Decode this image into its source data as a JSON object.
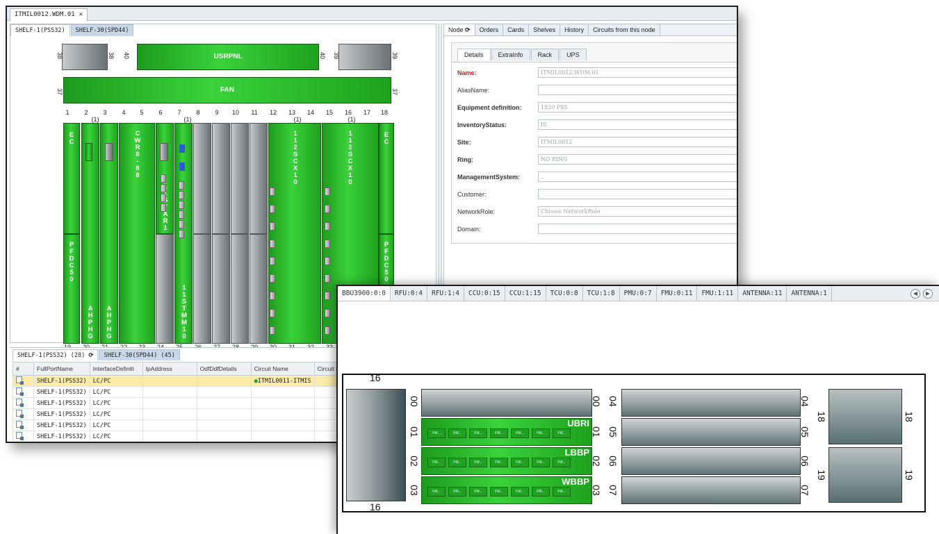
{
  "window_a": {
    "doc_tab": "ITMIL0012.WDM.01",
    "shelf_tabs": [
      "SHELF-1(PSS32)",
      "SHELF-30(SPD44)"
    ],
    "rack": {
      "top_labels": {
        "usrpnl": "USRPNL",
        "fan": "FAN"
      },
      "slot_numbers_top": [
        "1",
        "2",
        "3",
        "4",
        "5",
        "6",
        "7",
        "8",
        "9",
        "10",
        "11",
        "12",
        "13",
        "14",
        "15",
        "16",
        "17",
        "18"
      ],
      "slot_numbers_bottom": [
        "19",
        "20",
        "21",
        "22",
        "23",
        "24",
        "25",
        "26",
        "27",
        "28",
        "29",
        "30",
        "31",
        "32",
        "33"
      ],
      "slot_marks": [
        "(1)",
        "(1)",
        "(1)",
        "(1)"
      ],
      "side_numbers": {
        "n38a": "38",
        "n38b": "38",
        "n40a": "40",
        "n40b": "40",
        "n39a": "39",
        "n39b": "39",
        "n37a": "37",
        "n37b": "37"
      },
      "cards": {
        "ec_left": "E\nC",
        "ec_right": "E\nC",
        "cwr": "C\nW\nR\n8\n-\n8\n8",
        "pfdc_left": "P\nF\nD\nC\n5\n0",
        "pfdc_right": "P\nF\nD\nC\n5\n0",
        "ahphg_1": "A\nH\nP\nH\nG",
        "ahphg_2": "A\nH\nP\nH\nG",
        "star": "1\n1\nS\nT\nA\nR\n1",
        "stmm": "1\n1\nS\nT\nM\nM\n1\n0",
        "scx_1": "1\n1\n2\nS\nC\nX\n1\n0",
        "scx_2": "1\n1\n2\nS\nC\nX\n1\n0"
      }
    },
    "node_tabs": [
      "Node",
      "Orders",
      "Cards",
      "Shelves",
      "History",
      "Circuits from this node"
    ],
    "detail_tabs": [
      "Details",
      "ExtraInfo",
      "Rack",
      "UPS"
    ],
    "form": [
      {
        "label": "Name:",
        "value": "ITMIL0012.WDM.01"
      },
      {
        "label": "AliasName:",
        "value": ""
      },
      {
        "label": "Equipment definition:",
        "value": "1830 PSS"
      },
      {
        "label": "InventoryStatus:",
        "value": "IS"
      },
      {
        "label": "Site:",
        "value": "ITMIL0012"
      },
      {
        "label": "Ring:",
        "value": "NO RING"
      },
      {
        "label": "ManagementSystem:",
        "value": ".."
      },
      {
        "label": "Customer:",
        "value": ""
      },
      {
        "label": "NetworkRole:",
        "value": "Choose NetworkRole"
      },
      {
        "label": "Domain:",
        "value": ""
      }
    ],
    "bottom_tabs": [
      "SHELF-1(PSS32) (28)",
      "SHELF-30(SPD44) (45)"
    ],
    "table": {
      "columns": [
        "#",
        "FullPortName",
        "InterfaceDefiniti",
        "IpAddress",
        "OdfDdfDetails",
        "Circuit Name",
        "Circuit In"
      ],
      "rows": [
        [
          "SHELF-1(PSS32)",
          "LC/PC",
          "",
          "",
          "ITMIL0011-ITMIS"
        ],
        [
          "SHELF-1(PSS32)",
          "LC/PC",
          "",
          "",
          ""
        ],
        [
          "SHELF-1(PSS32)",
          "LC/PC",
          "",
          "",
          ""
        ],
        [
          "SHELF-1(PSS32)",
          "LC/PC",
          "",
          "",
          ""
        ],
        [
          "SHELF-1(PSS32)",
          "LC/PC",
          "",
          "",
          ""
        ],
        [
          "SHELF-1(PSS32)",
          "LC/PC",
          "",
          "",
          ""
        ]
      ]
    }
  },
  "window_b": {
    "tabs": [
      "BBU3900:0:0",
      "RFU:0:4",
      "RFU:1:4",
      "CCU:0:15",
      "CCU:1:15",
      "TCU:0:8",
      "TCU:1:8",
      "PMU:0:7",
      "FMU:0:11",
      "FMU:1:11",
      "ANTENNA:11",
      "ANTENNA:1"
    ],
    "bbu": {
      "slot16": "16",
      "left_slots": [
        "00",
        "01",
        "02",
        "03"
      ],
      "right_slots": [
        "04",
        "05",
        "06",
        "07"
      ],
      "fan_slots": [
        "18",
        "19"
      ],
      "card_names": {
        "s01": "UBRI",
        "s02": "LBBP",
        "s03": "WBBP"
      },
      "fm_label": "FM..."
    }
  },
  "colors": {
    "card_green": "#2cc22c",
    "selected_row": "#fbeaa8",
    "required_label": "#d02020"
  }
}
